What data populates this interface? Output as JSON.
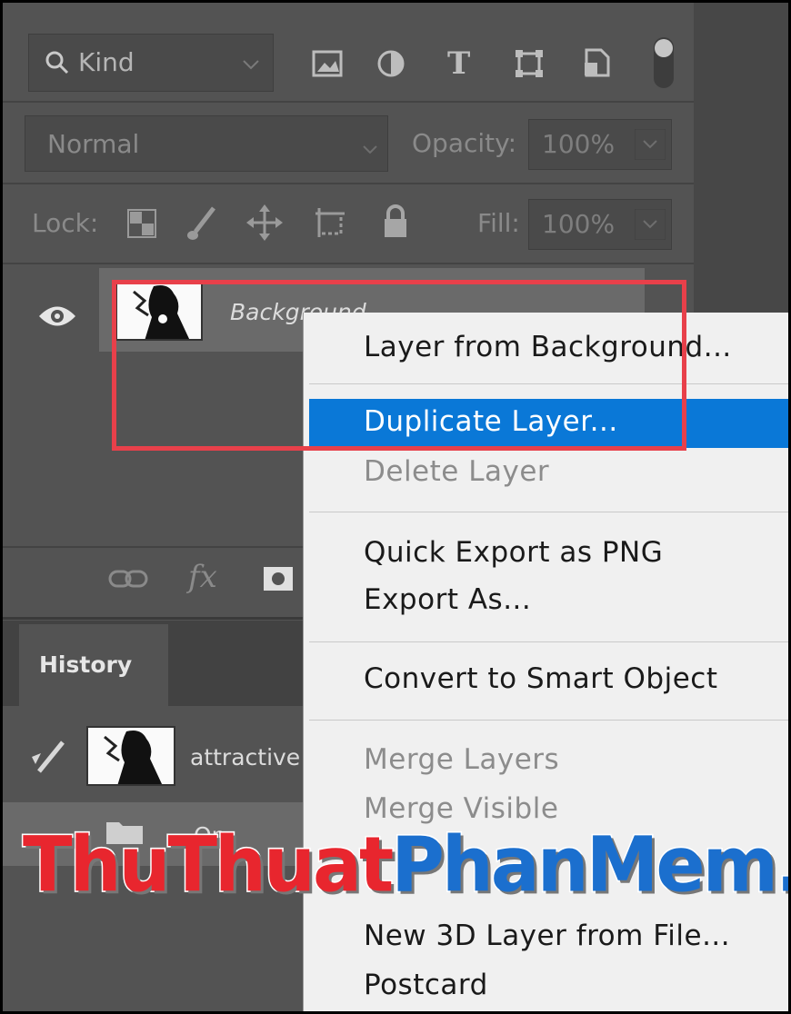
{
  "filter": {
    "kind_label": "Kind",
    "icons": [
      "image-filter-icon",
      "adjustment-filter-icon",
      "type-filter-icon",
      "shape-filter-icon",
      "smart-object-filter-icon"
    ]
  },
  "blend": {
    "mode": "Normal",
    "opacity_label": "Opacity:",
    "opacity_value": "100%"
  },
  "lock": {
    "label": "Lock:",
    "fill_label": "Fill:",
    "fill_value": "100%"
  },
  "layer": {
    "name": "Background",
    "visible": true
  },
  "footer": {
    "fx_label": "fx"
  },
  "history": {
    "tab_label": "History",
    "item_label": "attractive",
    "item2_label": "Op"
  },
  "context_menu": {
    "items": [
      {
        "label": "Layer from Background...",
        "enabled": true
      },
      {
        "label": "Duplicate Layer...",
        "enabled": true,
        "highlighted": true
      },
      {
        "label": "Delete Layer",
        "enabled": false
      },
      {
        "label": "Quick Export as PNG",
        "enabled": true
      },
      {
        "label": "Export As...",
        "enabled": true
      },
      {
        "label": "Convert to Smart Object",
        "enabled": true
      },
      {
        "label": "Merge Layers",
        "enabled": false
      },
      {
        "label": "Merge Visible",
        "enabled": false
      },
      {
        "label": "New 3D Layer from File...",
        "enabled": true
      },
      {
        "label": "Postcard",
        "enabled": true
      }
    ]
  },
  "watermark": {
    "part1": "ThuThuat",
    "part2": "PhanMem.vn"
  },
  "colors": {
    "panel": "#535353",
    "menu_bg": "#f0f0f0",
    "highlight": "#0a78d7",
    "annotation": "#e8404a"
  }
}
